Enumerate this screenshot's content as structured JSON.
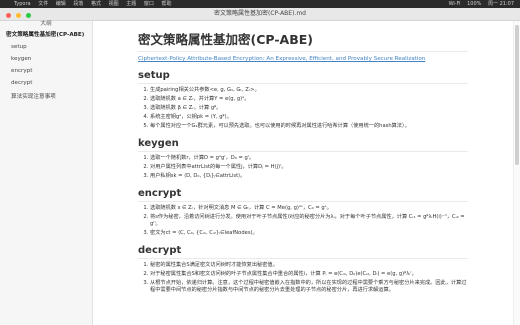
{
  "menubar": {
    "items": [
      "Typora",
      "文件",
      "编辑",
      "段落",
      "格式",
      "视图",
      "主题",
      "窗口",
      "帮助"
    ],
    "right": [
      "Wi-Fi",
      "100%",
      "周一 21:07"
    ]
  },
  "window": {
    "title": "密文策略属性基加密(CP-ABE).md"
  },
  "sidebar": {
    "title": "大纲",
    "items": [
      {
        "label": "密文策略属性基加密(CP-ABE)",
        "level": 1,
        "active": true
      },
      {
        "label": "setup",
        "level": 2
      },
      {
        "label": "keygen",
        "level": 2
      },
      {
        "label": "encrypt",
        "level": 2
      },
      {
        "label": "decrypt",
        "level": 2
      },
      {
        "label": "算法实现注意事项",
        "level": 2
      }
    ]
  },
  "doc": {
    "title": "密文策略属性基加密(CP-ABE)",
    "link": "Ciphertext-Policy Attribute-Based Encryption: An Expressive, Efficient, and Provably Secure Realization",
    "sections": [
      {
        "heading": "setup",
        "items": [
          "生成pairing相关公共参数<e, g, G₁, Gₜ, Zᵣ>。",
          "选取随机数 a ∈ Zᵣ，并计算Y = e(g, g)ᵃ。",
          "选取随机数 β ∈ Zᵣ，计算 gᵝ。",
          "系统主密钥gᵃ，公钥pk = ⟨Y, gᵝ⟩。",
          "每个属性对应一个G₁群元素，可以预先选取。也可以使用的时候再对属性进行哈希计算（使用统一的hash算法）。"
        ]
      },
      {
        "heading": "keygen",
        "items": [
          "选取一个随机数r，计算D = gᵃgʳ，D₀ = gʳ。",
          "对用户属性列表中attrList的每一个属性j，计算Dⱼ = H(j)ʳ。",
          "用户私钥sk = ⟨D, D₀, {Dⱼ}ⱼ∈attrList⟩。"
        ]
      },
      {
        "heading": "encrypt",
        "items": [
          "选取随机数 s ∈ Zᵣ，针对明文消息 M ∈ Gₜ，计算 C = Me(g, g)ᵃˢ，C₀ = gˢ。",
          "将s作为秘密，沿着访问树进行分发。使用对于叶子节点属性i对应的秘密分片为λᵢ，对于每个叶子节点属性，计算 Cᵢ₁ = gᵝλᵢH(i)⁻ʳⁱ，Cᵢ₂ = gʳⁱ。",
          "密文为ct = ⟨C, C₀, {Cᵢ₁, Cᵢ₂}ᵢ∈leafNodes⟩。"
        ]
      },
      {
        "heading": "decrypt",
        "items": [
          "秘密的属性集合S满足密文访问树时才能恢复出秘密值。",
          "对于秘密属性集合S和密文访问树的叶子节点属性集合中重合的属性i，计算 Pᵢ = e(Cᵢ₁, D₀)e(Cᵢ₂, Dᵢ) = e(g, g)ᵝλᵢʳ。",
          "从根节点开始，依递归计算。注意，这个过程中秘密值嵌入在指数中的，所以在实现的过程中需要个乘方与秘密分片来完成。因此，计算过程中需要中间节点的秘密分片指数与中间节点的秘密分片去重处理的子节点的秘密分片，再进行求解运算。"
        ]
      }
    ]
  },
  "colors": {
    "link": "#4183c4",
    "close": "#fe5f57",
    "minimize": "#febc2e",
    "zoom": "#28c840"
  }
}
